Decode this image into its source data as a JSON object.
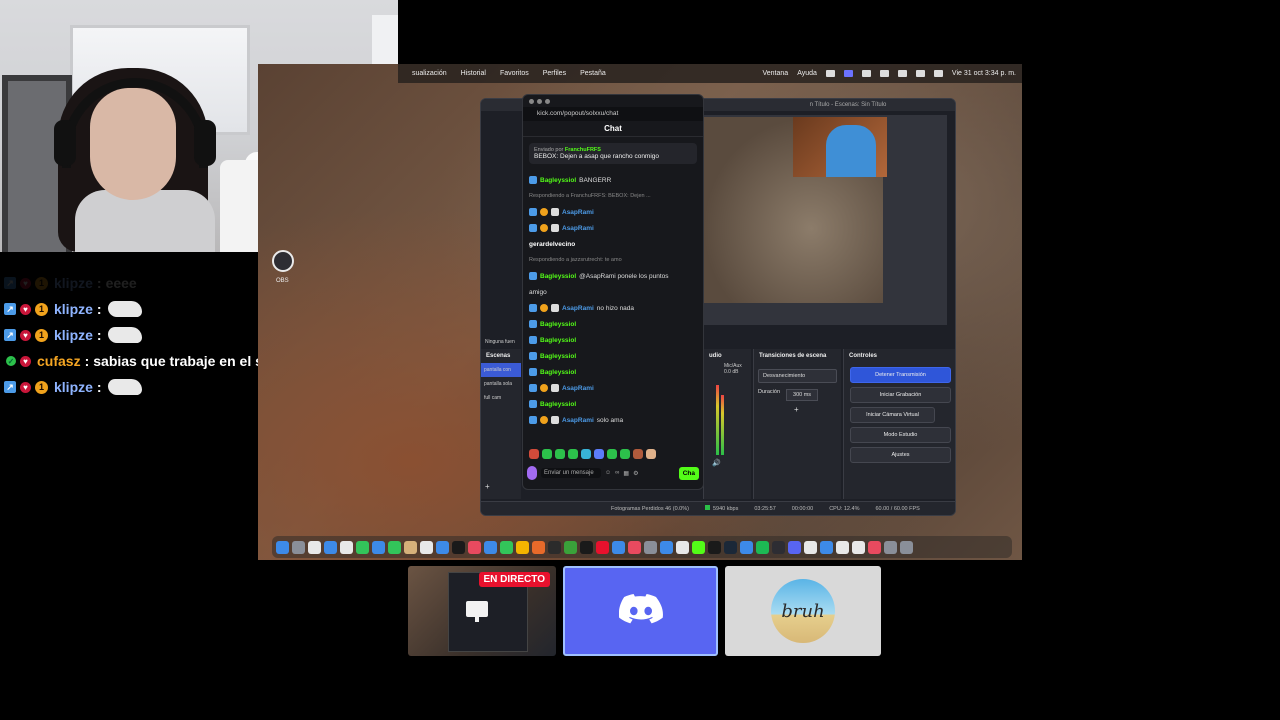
{
  "chat_overlay": {
    "messages": [
      {
        "user": "klipze",
        "text": "eeee",
        "color": "#8fb4ff",
        "faded": true
      },
      {
        "user": "klipze",
        "text": "",
        "color": "#8fb4ff",
        "emote": true
      },
      {
        "user": "klipze",
        "text": "",
        "color": "#8fb4ff",
        "emote": true
      },
      {
        "user": "cufasz",
        "text": "sabias que trabaje en el shoping de mesero",
        "color": "#f5a623"
      },
      {
        "user": "klipze",
        "text": "",
        "color": "#8fb4ff",
        "emote": true
      }
    ]
  },
  "desktop": {
    "menubar": {
      "items": [
        "sualización",
        "Historial",
        "Favoritos",
        "Perfiles",
        "Pestaña"
      ],
      "right_items": [
        "Ventana",
        "Ayuda"
      ],
      "clock": "Vie 31 oct 3:34 p. m."
    },
    "desktop_icon_label": "OBS",
    "obs": {
      "title": "n Título - Escenas: Sin Título",
      "scenes_header": "Escenas",
      "no_source": "Ninguna fuen",
      "scenes": [
        "pantalla con",
        "pantalla sola",
        "full cam"
      ],
      "mixer_header": "udio",
      "mixer_label": "Mic/Aux",
      "mixer_db": "0.0 dB",
      "transitions_header": "Transiciones de escena",
      "transition_selected": "Desvanecimiento",
      "duration_label": "Duración",
      "duration_value": "300 ms",
      "controls_header": "Controles",
      "buttons": [
        "Detener Transmisión",
        "Iniciar Grabación",
        "Iniciar Cámara Virtual",
        "Modo Estudio",
        "Ajustes"
      ],
      "status": {
        "dropped": "Fotogramas Perdidos 46 (0.0%)",
        "bitrate": "5940 kbps",
        "time": "03:25:57",
        "rec_time": "00:00:00",
        "cpu": "CPU: 12.4%",
        "fps": "60.00 / 60.00 FPS"
      }
    },
    "kick_chat": {
      "url": "kick.com/popout/solxxu/chat",
      "title": "Chat",
      "pinned_by_label": "Enviado por",
      "pinned_by_user": "FranchuFRFS",
      "pinned_text": "BEBOX: Dejen a asap que rancho conmigo",
      "messages": [
        {
          "user": "Bagleyssiol",
          "text": "BANGERR",
          "color": "#53fc18"
        },
        {
          "reply": "Respondiendo a FranchuFRFS: BEBOX: Dejen ..."
        },
        {
          "user": "AsapRami",
          "text": "",
          "color": "#4c9be8"
        },
        {
          "user": "AsapRami",
          "text": "",
          "color": "#4c9be8"
        },
        {
          "user": "gerardelvecino",
          "text": "",
          "color": "#ffffff"
        },
        {
          "reply": "Respondiendo a jazzsrutrecht: te amo"
        },
        {
          "user": "Bagleyssiol",
          "text": "@AsapRami ponele los puntos",
          "color": "#53fc18"
        },
        {
          "user": "",
          "text": "amigo",
          "color": "#dddddd"
        },
        {
          "user": "AsapRami",
          "text": "no hizo nada",
          "color": "#4c9be8"
        },
        {
          "user": "Bagleyssiol",
          "text": "",
          "color": "#53fc18"
        },
        {
          "user": "Bagleyssiol",
          "text": "",
          "color": "#53fc18"
        },
        {
          "user": "Bagleyssiol",
          "text": "",
          "color": "#53fc18"
        },
        {
          "user": "Bagleyssiol",
          "text": "",
          "color": "#53fc18"
        },
        {
          "user": "AsapRami",
          "text": "",
          "color": "#4c9be8"
        },
        {
          "user": "Bagleyssiol",
          "text": "",
          "color": "#53fc18"
        },
        {
          "user": "AsapRami",
          "text": "solo ama",
          "color": "#4c9be8"
        }
      ],
      "input_placeholder": "Enviar un mensaje",
      "send_label": "Cha"
    }
  },
  "stream_deck": {
    "live_badge": "EN DIRECTO",
    "bruh_label": "bruh"
  },
  "colors": {
    "kick_green": "#53fc18",
    "discord": "#5865f2",
    "obs_primary": "#2f56d9"
  }
}
